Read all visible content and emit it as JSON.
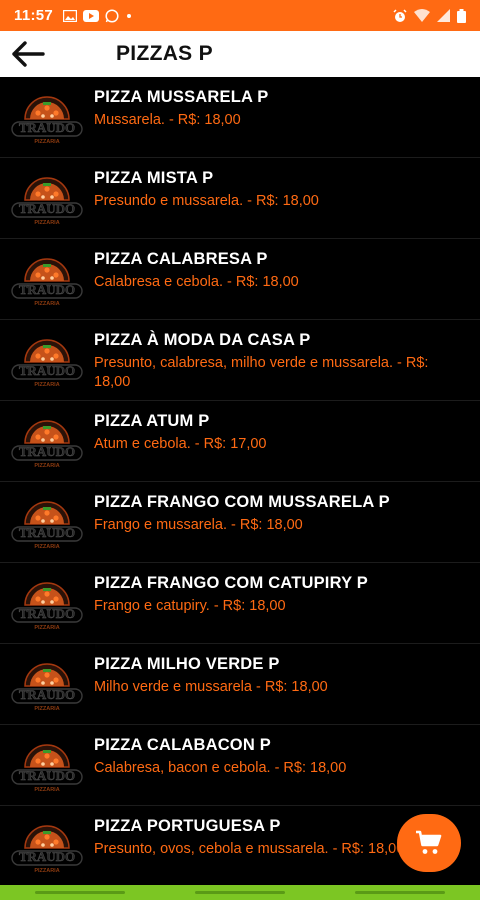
{
  "status_bar": {
    "time": "11:57",
    "left_icons": [
      "gallery-icon",
      "youtube-icon",
      "whatsapp-icon",
      "notification-dot-icon"
    ],
    "right_icons": [
      "alarm-icon",
      "wifi-icon",
      "signal-icon",
      "battery-icon"
    ]
  },
  "app_bar": {
    "title": "PIZZAS P",
    "back_icon": "arrow-left-icon"
  },
  "colors": {
    "accent": "#ff6a13",
    "background": "#000000",
    "nav_bar": "#7cc623",
    "app_bar": "#ffffff"
  },
  "items": [
    {
      "name": "PIZZA MUSSARELA P",
      "description": "Mussarela. - R$: 18,00"
    },
    {
      "name": "PIZZA MISTA P",
      "description": "Presundo e mussarela. - R$: 18,00"
    },
    {
      "name": "PIZZA CALABRESA P",
      "description": "Calabresa e cebola. - R$: 18,00"
    },
    {
      "name": "PIZZA À MODA DA CASA P",
      "description": "Presunto, calabresa,  milho verde e mussarela.  - R$: 18,00"
    },
    {
      "name": "PIZZA ATUM P",
      "description": "Atum e cebola. - R$: 17,00"
    },
    {
      "name": "PIZZA FRANGO COM MUSSARELA P",
      "description": "Frango e mussarela. - R$: 18,00"
    },
    {
      "name": "PIZZA FRANGO COM CATUPIRY P",
      "description": "Frango e catupiry. - R$: 18,00"
    },
    {
      "name": "PIZZA MILHO VERDE  P",
      "description": "Milho verde e mussarela - R$: 18,00"
    },
    {
      "name": "PIZZA CALABACON P",
      "description": "Calabresa, bacon e cebola. - R$: 18,00"
    },
    {
      "name": "PIZZA PORTUGUESA P",
      "description": "Presunto, ovos, cebola e mussarela. - R$: 18,00"
    }
  ],
  "fab": {
    "icon": "shopping-cart-icon"
  }
}
